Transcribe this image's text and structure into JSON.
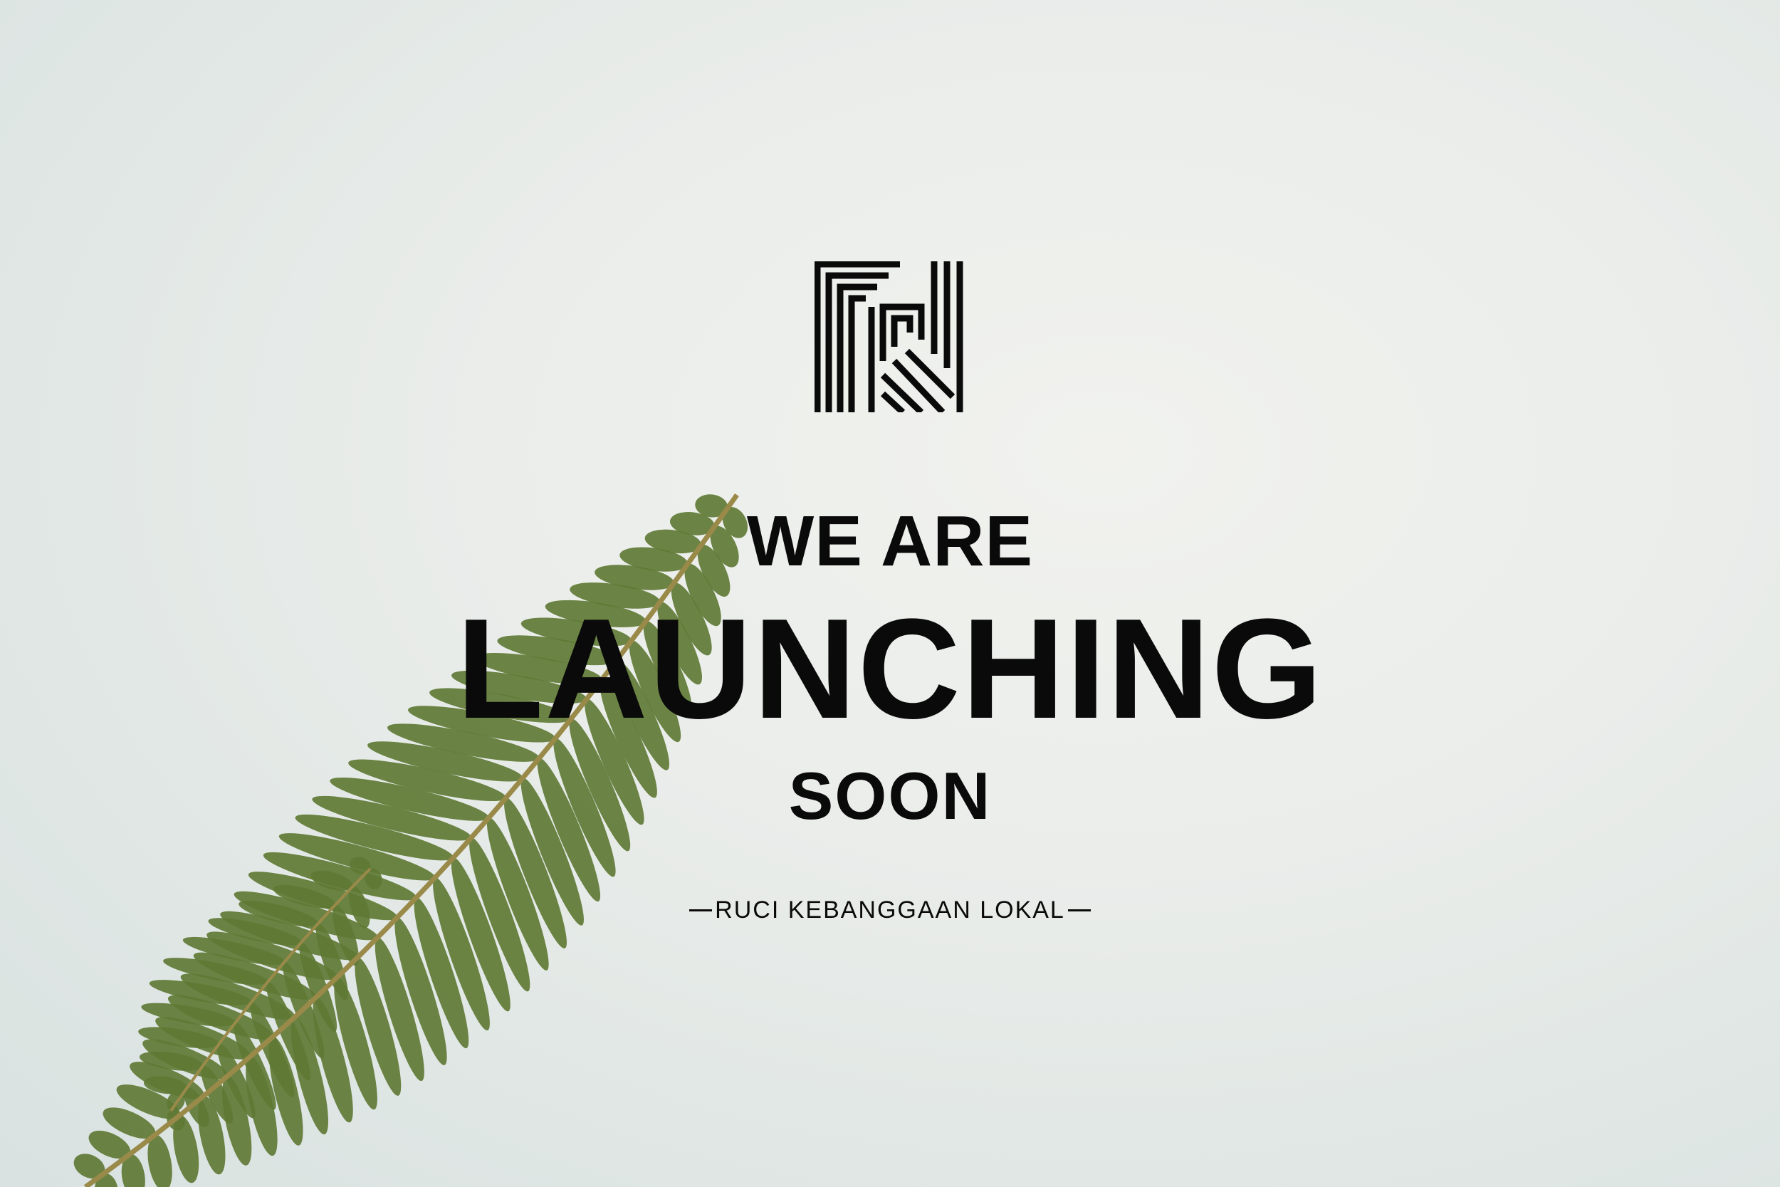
{
  "brand": {
    "logo_icon": "ruci-monogram-logo-icon",
    "text_color": "#0a0a0a",
    "fern_color": "#5f7a35"
  },
  "headline": {
    "top": "WE ARE",
    "main": "LAUNCHING",
    "bottom": "SOON"
  },
  "tagline": {
    "text": "RUCI KEBANGGAAN LOKAL"
  }
}
